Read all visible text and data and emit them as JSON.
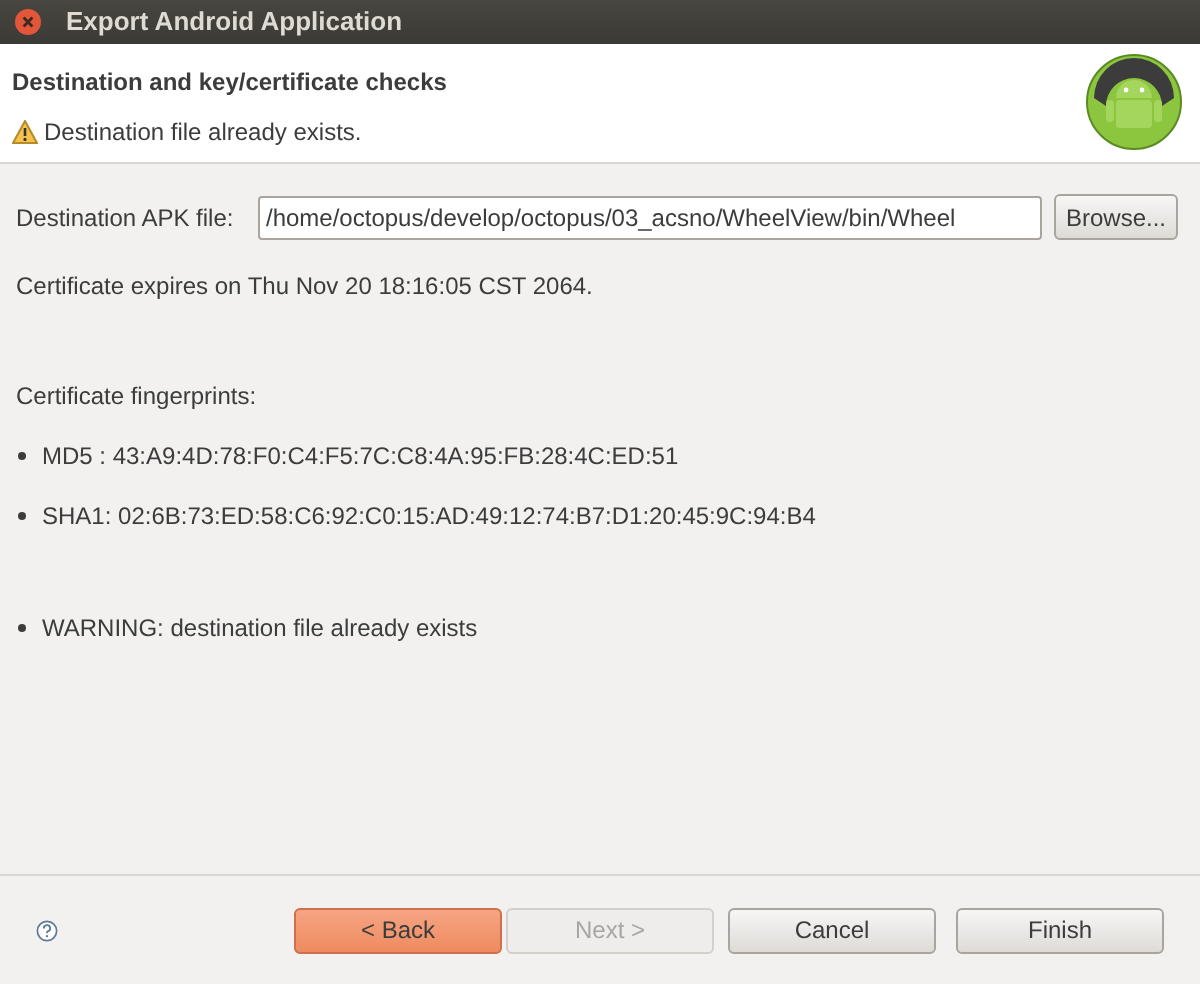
{
  "window": {
    "title": "Export Android Application"
  },
  "header": {
    "title": "Destination and key/certificate checks",
    "message": "Destination file already exists."
  },
  "destination": {
    "label": "Destination APK file:",
    "value": "/home/octopus/develop/octopus/03_acsno/WheelView/bin/Wheel",
    "browse": "Browse..."
  },
  "expiry": "Certificate expires on Thu Nov 20 18:16:05 CST 2064.",
  "fingerprints": {
    "title": "Certificate fingerprints:",
    "items": [
      "MD5 : 43:A9:4D:78:F0:C4:F5:7C:C8:4A:95:FB:28:4C:ED:51",
      "SHA1: 02:6B:73:ED:58:C6:92:C0:15:AD:49:12:74:B7:D1:20:45:9C:94:B4"
    ]
  },
  "warnings": [
    "WARNING: destination file already exists"
  ],
  "buttons": [
    {
      "label": "< Back",
      "disabled": false,
      "selected": true
    },
    {
      "label": "Next >",
      "disabled": true,
      "selected": false
    },
    {
      "label": "Cancel",
      "disabled": false,
      "selected": false
    },
    {
      "label": "Finish",
      "disabled": false,
      "selected": false
    }
  ]
}
